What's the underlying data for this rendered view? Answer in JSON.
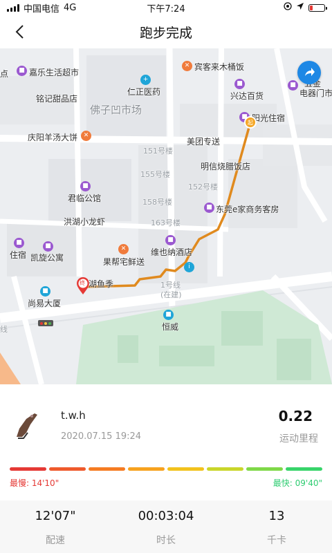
{
  "status_bar": {
    "carrier": "中国电信",
    "network": "4G",
    "time": "下午7:24"
  },
  "header": {
    "title": "跑步完成"
  },
  "map": {
    "buildings_labels": [
      "151号楼",
      "155号楼",
      "152号楼",
      "158号楼",
      "163号楼"
    ],
    "pois": [
      {
        "label": "嘉乐生活超市"
      },
      {
        "label": "宾客来木桶饭"
      },
      {
        "label": "仁正医药"
      },
      {
        "label": "兴达百货"
      },
      {
        "label": "铭记甜品店"
      },
      {
        "label": "佛子凹市场"
      },
      {
        "label": "阳光住宿"
      },
      {
        "label": "庆阳羊汤大饼"
      },
      {
        "label": "美团专送"
      },
      {
        "label": "明信烧腊饭店"
      },
      {
        "label": "君临公馆"
      },
      {
        "label": "东莞e家商务客房"
      },
      {
        "label": "洪湖小龙虾"
      },
      {
        "label": "住宿"
      },
      {
        "label": "凯旋公寓"
      },
      {
        "label": "维也纳酒店"
      },
      {
        "label": "果帮宅鲜送"
      },
      {
        "label": "湖鱼季"
      },
      {
        "label": "1号线"
      },
      {
        "label": "(在建)"
      },
      {
        "label": "尚易大厦"
      },
      {
        "label": "恒威"
      },
      {
        "label": "五金"
      },
      {
        "label": "电器门市"
      },
      {
        "label": "点"
      },
      {
        "label": "线"
      }
    ],
    "start_marker": "起",
    "end_marker": "终",
    "route_color": "#E08A1E"
  },
  "summary": {
    "user_name": "t.w.h",
    "date": "2020.07.15 19:24",
    "distance": "0.22",
    "distance_label": "运动里程",
    "slowest_label": "最慢: 14'10\"",
    "fastest_label": "最快: 09'40\"",
    "pace_colors": [
      "#e53935",
      "#ef5a2c",
      "#f57c22",
      "#f7a21f",
      "#f2c21d",
      "#c9d62a",
      "#7fd848",
      "#38d46a"
    ]
  },
  "stats": [
    {
      "value": "12'07\"",
      "label": "配速"
    },
    {
      "value": "00:03:04",
      "label": "时长"
    },
    {
      "value": "13",
      "label": "千卡"
    }
  ]
}
